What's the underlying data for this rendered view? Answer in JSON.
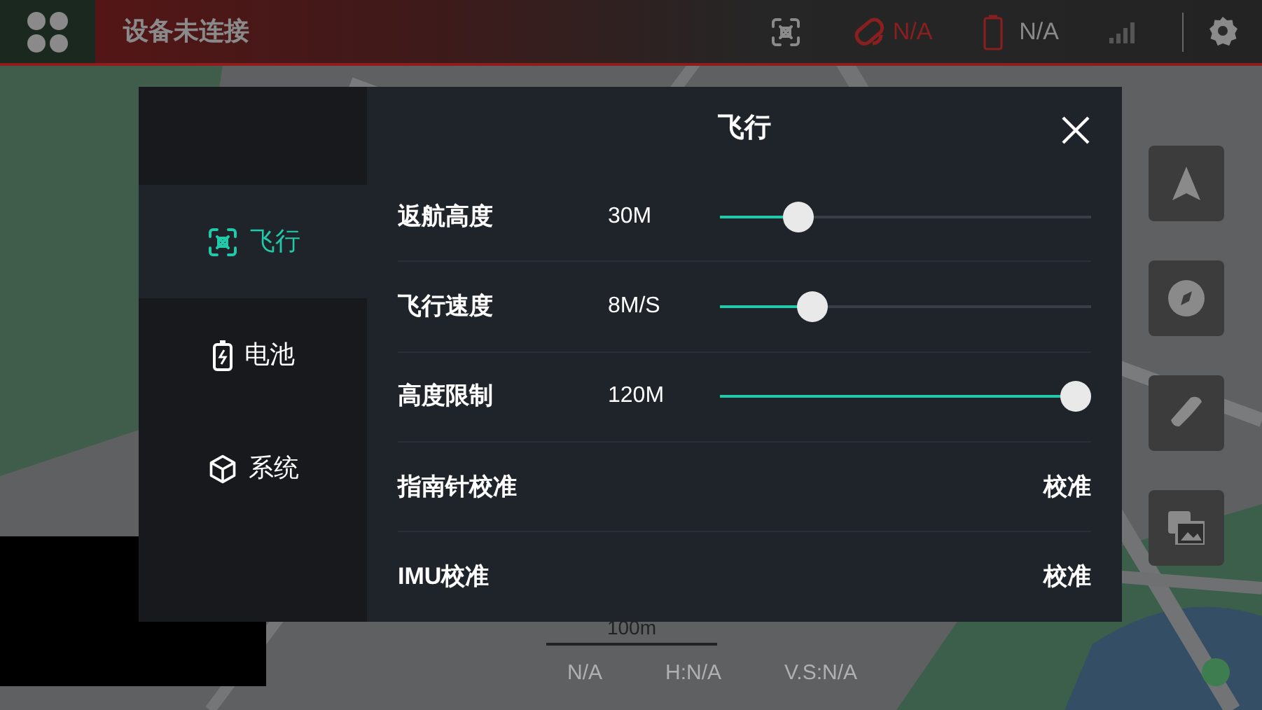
{
  "status_bar": {
    "connection": "设备未连接",
    "signal_reading": "N/A",
    "battery_reading": "N/A"
  },
  "map_overlay": {
    "scale": "100m",
    "telemetry": [
      "N/A",
      "H:N/A",
      "V.S:N/A"
    ]
  },
  "dialog": {
    "title": "飞行",
    "tabs": [
      {
        "label": "飞行",
        "kind": "drone",
        "selected": true
      },
      {
        "label": "电池",
        "kind": "battery",
        "selected": false
      },
      {
        "label": "系统",
        "kind": "cube",
        "selected": false
      }
    ],
    "rows": [
      {
        "kind": "slider",
        "label": "返航高度",
        "reading": "30M",
        "level": 0.21
      },
      {
        "kind": "slider",
        "label": "飞行速度",
        "reading": "8M/S",
        "level": 0.25
      },
      {
        "kind": "slider",
        "label": "高度限制",
        "reading": "120M",
        "level": 0.96
      },
      {
        "kind": "action",
        "label": "指南针校准",
        "action": "校准"
      },
      {
        "kind": "action",
        "label": "IMU校准",
        "action": "校准"
      }
    ]
  }
}
